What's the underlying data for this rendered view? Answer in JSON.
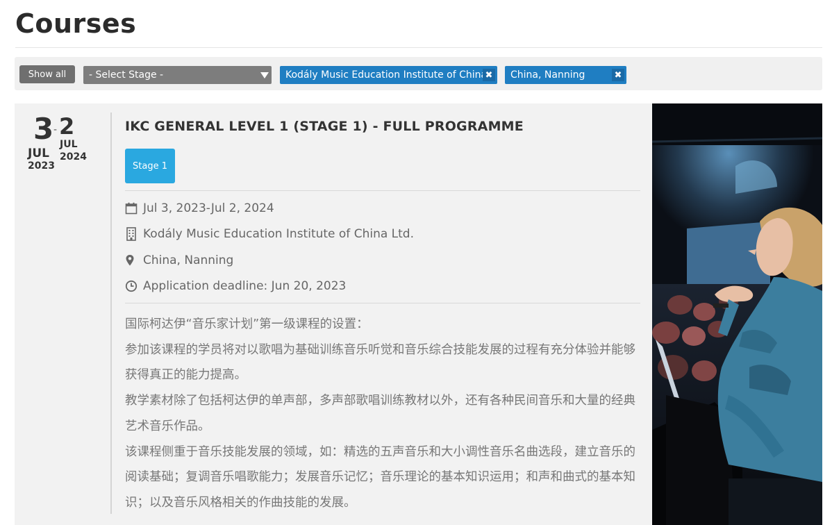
{
  "page": {
    "title": "Courses"
  },
  "filters": {
    "show_all_label": "Show all",
    "stage_select_value": "- Select Stage -",
    "chips": [
      {
        "label": "Kodály Music Education Institute of China Ltd."
      },
      {
        "label": "China, Nanning"
      }
    ],
    "chip_remove_symbol": "✖"
  },
  "course": {
    "date": {
      "start_day": "3",
      "start_month": "JUL",
      "start_year": "2023",
      "separator": "-",
      "end_day": "2",
      "end_month": "JUL",
      "end_year": "2024"
    },
    "title": "IKC GENERAL LEVEL 1 (STAGE 1) - FULL PROGRAMME",
    "stage_badge": "Stage 1",
    "meta": {
      "dates": "Jul 3, 2023-Jul 2, 2024",
      "institute": "Kodály Music Education Institute of China Ltd.",
      "location": "China, Nanning",
      "deadline": "Application deadline: Jun 20, 2023"
    },
    "description": [
      "国际柯达伊“音乐家计划”第一级课程的设置：",
      "参加该课程的学员将对以歌唱为基础训练音乐听觉和音乐综合技能发展的过程有充分体验并能够获得真正的能力提高。",
      "教学素材除了包括柯达伊的单声部，多声部歌唱训练教材以外，还有各种民间音乐和大量的经典艺术音乐作品。",
      "该课程侧重于音乐技能发展的领域，如：精选的五声音乐和大小调性音乐名曲选段，建立音乐的阅读基础；复调音乐唱歌能力；发展音乐记忆；音乐理论的基本知识运用；和声和曲式的基本知识；以及音乐风格相关的作曲技能的发展。"
    ]
  },
  "colors": {
    "chip_blue": "#1f7ec2",
    "stage_badge_blue": "#2aa8e0",
    "button_gray": "#6f6f6f"
  },
  "icons": {
    "dates": "calendar-icon",
    "institute": "building-icon",
    "location": "map-marker-icon",
    "deadline": "clock-icon"
  }
}
